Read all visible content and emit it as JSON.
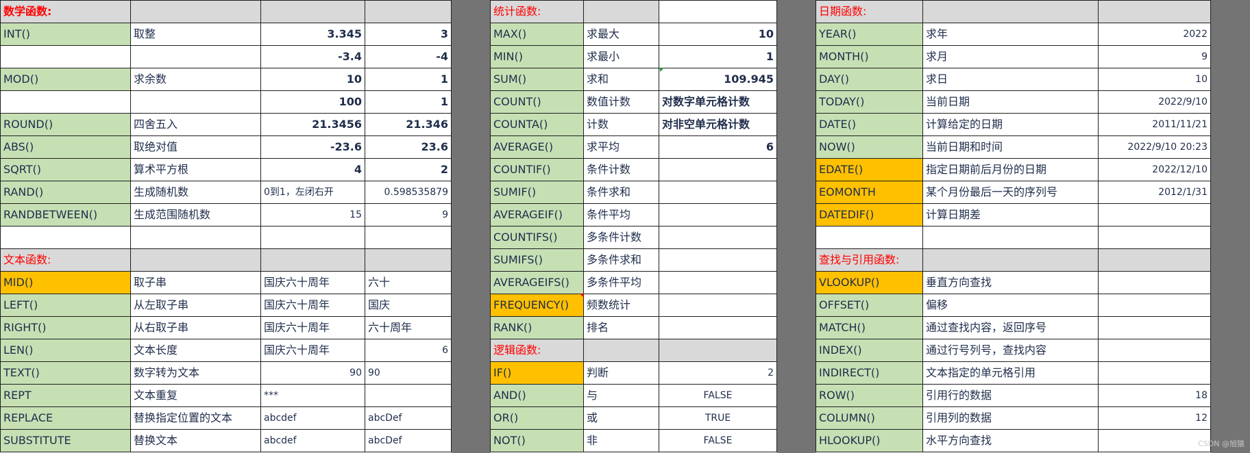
{
  "panels": {
    "left": {
      "widths": [
        190,
        190,
        152,
        126
      ],
      "rows": [
        [
          {
            "t": "数学函数:",
            "s": "hd b"
          },
          {
            "t": "",
            "s": "hd"
          },
          {
            "t": "",
            "s": "hd"
          },
          {
            "t": "",
            "s": "hd"
          }
        ],
        [
          {
            "t": "INT()",
            "s": "fn"
          },
          {
            "t": "取整",
            "s": ""
          },
          {
            "t": "3.345",
            "s": "r b"
          },
          {
            "t": "3",
            "s": "r b"
          }
        ],
        [
          {
            "t": "",
            "s": ""
          },
          {
            "t": "",
            "s": ""
          },
          {
            "t": "-3.4",
            "s": "r b"
          },
          {
            "t": "-4",
            "s": "r b"
          }
        ],
        [
          {
            "t": "MOD()",
            "s": "fn"
          },
          {
            "t": "求余数",
            "s": ""
          },
          {
            "t": "10",
            "s": "r b"
          },
          {
            "t": "1",
            "s": "r b"
          }
        ],
        [
          {
            "t": "",
            "s": ""
          },
          {
            "t": "",
            "s": ""
          },
          {
            "t": "100",
            "s": "r b"
          },
          {
            "t": "1",
            "s": "r b"
          }
        ],
        [
          {
            "t": "ROUND()",
            "s": "fn"
          },
          {
            "t": "四舍五入",
            "s": ""
          },
          {
            "t": "21.3456",
            "s": "r b"
          },
          {
            "t": "21.346",
            "s": "r b"
          }
        ],
        [
          {
            "t": "ABS()",
            "s": "fn"
          },
          {
            "t": "取绝对值",
            "s": ""
          },
          {
            "t": "-23.6",
            "s": "r b"
          },
          {
            "t": "23.6",
            "s": "r b"
          }
        ],
        [
          {
            "t": "SQRT()",
            "s": "fn"
          },
          {
            "t": "算术平方根",
            "s": ""
          },
          {
            "t": "4",
            "s": "r b"
          },
          {
            "t": "2",
            "s": "r b"
          }
        ],
        [
          {
            "t": "RAND()",
            "s": "fn"
          },
          {
            "t": "生成随机数",
            "s": ""
          },
          {
            "t": "0到1，左闭右开",
            "s": "sm"
          },
          {
            "t": "0.598535879",
            "s": "r sm"
          }
        ],
        [
          {
            "t": "RANDBETWEEN()",
            "s": "fn"
          },
          {
            "t": "生成范围随机数",
            "s": ""
          },
          {
            "t": "15",
            "s": "r sm"
          },
          {
            "t": "9",
            "s": "r sm"
          }
        ],
        [
          {
            "t": "",
            "s": ""
          },
          {
            "t": "",
            "s": ""
          },
          {
            "t": "",
            "s": ""
          },
          {
            "t": "",
            "s": ""
          }
        ],
        [
          {
            "t": "文本函数:",
            "s": "hd"
          },
          {
            "t": "",
            "s": "hd"
          },
          {
            "t": "",
            "s": "hd"
          },
          {
            "t": "",
            "s": "hd"
          }
        ],
        [
          {
            "t": "MID()",
            "s": "fy"
          },
          {
            "t": "取子串",
            "s": ""
          },
          {
            "t": "国庆六十周年",
            "s": ""
          },
          {
            "t": "六十",
            "s": ""
          }
        ],
        [
          {
            "t": "LEFT()",
            "s": "fn"
          },
          {
            "t": "从左取子串",
            "s": ""
          },
          {
            "t": "国庆六十周年",
            "s": ""
          },
          {
            "t": "国庆",
            "s": ""
          }
        ],
        [
          {
            "t": "RIGHT()",
            "s": "fn"
          },
          {
            "t": "从右取子串",
            "s": ""
          },
          {
            "t": "国庆六十周年",
            "s": ""
          },
          {
            "t": "六十周年",
            "s": ""
          }
        ],
        [
          {
            "t": "LEN()",
            "s": "fn"
          },
          {
            "t": "文本长度",
            "s": ""
          },
          {
            "t": "国庆六十周年",
            "s": ""
          },
          {
            "t": "6",
            "s": "r sm"
          }
        ],
        [
          {
            "t": "TEXT()",
            "s": "fn"
          },
          {
            "t": "数字转为文本",
            "s": ""
          },
          {
            "t": "90",
            "s": "r sm"
          },
          {
            "t": "90",
            "s": "sm"
          }
        ],
        [
          {
            "t": "REPT",
            "s": "fn"
          },
          {
            "t": "文本重复",
            "s": ""
          },
          {
            "t": "***",
            "s": "sm"
          },
          {
            "t": "",
            "s": ""
          }
        ],
        [
          {
            "t": "REPLACE",
            "s": "fn"
          },
          {
            "t": "替换指定位置的文本",
            "s": ""
          },
          {
            "t": "abcdef",
            "s": "sm"
          },
          {
            "t": "abcDef",
            "s": "sm"
          }
        ],
        [
          {
            "t": "SUBSTITUTE",
            "s": "fn"
          },
          {
            "t": "替换文本",
            "s": ""
          },
          {
            "t": "abcdef",
            "s": "sm"
          },
          {
            "t": "abcDef",
            "s": "sm"
          }
        ]
      ]
    },
    "middle": {
      "widths": [
        136,
        110,
        172
      ],
      "rows": [
        [
          {
            "t": "统计函数:",
            "s": "hd"
          },
          {
            "t": "",
            "s": "hd"
          },
          {
            "t": "",
            "s": ""
          }
        ],
        [
          {
            "t": "MAX()",
            "s": "fn"
          },
          {
            "t": "求最大",
            "s": ""
          },
          {
            "t": "10",
            "s": "r b"
          }
        ],
        [
          {
            "t": "MIN()",
            "s": "fn"
          },
          {
            "t": "求最小",
            "s": ""
          },
          {
            "t": "1",
            "s": "r b"
          }
        ],
        [
          {
            "t": "SUM()",
            "s": "fn"
          },
          {
            "t": "求和",
            "s": ""
          },
          {
            "t": "109.945",
            "s": "r b"
          }
        ],
        [
          {
            "t": "COUNT()",
            "s": "fn"
          },
          {
            "t": "数值计数",
            "s": ""
          },
          {
            "t": "对数字单元格计数",
            "s": "b"
          }
        ],
        [
          {
            "t": "COUNTA()",
            "s": "fn"
          },
          {
            "t": "计数",
            "s": ""
          },
          {
            "t": "对非空单元格计数",
            "s": "b"
          }
        ],
        [
          {
            "t": "AVERAGE()",
            "s": "fn"
          },
          {
            "t": "求平均",
            "s": ""
          },
          {
            "t": "6",
            "s": "r b"
          }
        ],
        [
          {
            "t": "COUNTIF()",
            "s": "fn"
          },
          {
            "t": "条件计数",
            "s": ""
          },
          {
            "t": "",
            "s": ""
          }
        ],
        [
          {
            "t": "SUMIF()",
            "s": "fn"
          },
          {
            "t": "条件求和",
            "s": ""
          },
          {
            "t": "",
            "s": ""
          }
        ],
        [
          {
            "t": "AVERAGEIF()",
            "s": "fn"
          },
          {
            "t": "条件平均",
            "s": ""
          },
          {
            "t": "",
            "s": ""
          }
        ],
        [
          {
            "t": "COUNTIFS()",
            "s": "fn"
          },
          {
            "t": "多条件计数",
            "s": ""
          },
          {
            "t": "",
            "s": ""
          }
        ],
        [
          {
            "t": "SUMIFS()",
            "s": "fn"
          },
          {
            "t": "多条件求和",
            "s": ""
          },
          {
            "t": "",
            "s": ""
          }
        ],
        [
          {
            "t": "AVERAGEIFS()",
            "s": "fn"
          },
          {
            "t": "多条件平均",
            "s": ""
          },
          {
            "t": "",
            "s": ""
          }
        ],
        [
          {
            "t": "FREQUENCY()",
            "s": "fy"
          },
          {
            "t": "频数统计",
            "s": ""
          },
          {
            "t": "",
            "s": ""
          }
        ],
        [
          {
            "t": "RANK()",
            "s": "fn"
          },
          {
            "t": "排名",
            "s": ""
          },
          {
            "t": "",
            "s": ""
          }
        ],
        [
          {
            "t": "逻辑函数:",
            "s": "hd"
          },
          {
            "t": "",
            "s": "hd"
          },
          {
            "t": "",
            "s": "hd"
          }
        ],
        [
          {
            "t": "IF()",
            "s": "fy"
          },
          {
            "t": "判断",
            "s": ""
          },
          {
            "t": "2",
            "s": "r sm"
          }
        ],
        [
          {
            "t": "AND()",
            "s": "fn"
          },
          {
            "t": "与",
            "s": ""
          },
          {
            "t": "FALSE",
            "s": "c sm"
          }
        ],
        [
          {
            "t": "OR()",
            "s": "fn"
          },
          {
            "t": "或",
            "s": ""
          },
          {
            "t": "TRUE",
            "s": "c sm"
          }
        ],
        [
          {
            "t": "NOT()",
            "s": "fn"
          },
          {
            "t": "非",
            "s": ""
          },
          {
            "t": "FALSE",
            "s": "c sm"
          }
        ]
      ]
    },
    "right": {
      "widths": [
        156,
        256,
        164
      ],
      "rows": [
        [
          {
            "t": "日期函数:",
            "s": "hd"
          },
          {
            "t": "",
            "s": "hd"
          },
          {
            "t": "",
            "s": "hd"
          }
        ],
        [
          {
            "t": "YEAR()",
            "s": "fn"
          },
          {
            "t": "求年",
            "s": ""
          },
          {
            "t": "2022",
            "s": "r sm"
          }
        ],
        [
          {
            "t": "MONTH()",
            "s": "fn"
          },
          {
            "t": "求月",
            "s": ""
          },
          {
            "t": "9",
            "s": "r sm"
          }
        ],
        [
          {
            "t": "DAY()",
            "s": "fn"
          },
          {
            "t": "求日",
            "s": ""
          },
          {
            "t": "10",
            "s": "r sm"
          }
        ],
        [
          {
            "t": "TODAY()",
            "s": "fn"
          },
          {
            "t": "当前日期",
            "s": ""
          },
          {
            "t": "2022/9/10",
            "s": "r sm"
          }
        ],
        [
          {
            "t": "DATE()",
            "s": "fn"
          },
          {
            "t": "计算给定的日期",
            "s": ""
          },
          {
            "t": "2011/11/21",
            "s": "r sm"
          }
        ],
        [
          {
            "t": "NOW()",
            "s": "fn"
          },
          {
            "t": "当前日期和时间",
            "s": ""
          },
          {
            "t": "2022/9/10 20:23",
            "s": "r sm"
          }
        ],
        [
          {
            "t": "EDATE()",
            "s": "fy"
          },
          {
            "t": "指定日期前后月份的日期",
            "s": ""
          },
          {
            "t": "2022/12/10",
            "s": "r sm"
          }
        ],
        [
          {
            "t": "EOMONTH",
            "s": "fy"
          },
          {
            "t": "某个月份最后一天的序列号",
            "s": ""
          },
          {
            "t": "2012/1/31",
            "s": "r sm"
          }
        ],
        [
          {
            "t": "DATEDIF()",
            "s": "fy"
          },
          {
            "t": "计算日期差",
            "s": ""
          },
          {
            "t": "",
            "s": ""
          }
        ],
        [
          {
            "t": "",
            "s": ""
          },
          {
            "t": "",
            "s": ""
          },
          {
            "t": "",
            "s": ""
          }
        ],
        [
          {
            "t": "查找与引用函数:",
            "s": "hd"
          },
          {
            "t": "",
            "s": "hd"
          },
          {
            "t": "",
            "s": "hd"
          }
        ],
        [
          {
            "t": "VLOOKUP()",
            "s": "fy"
          },
          {
            "t": "垂直方向查找",
            "s": ""
          },
          {
            "t": "",
            "s": ""
          }
        ],
        [
          {
            "t": "OFFSET()",
            "s": "fn"
          },
          {
            "t": "偏移",
            "s": ""
          },
          {
            "t": "",
            "s": ""
          }
        ],
        [
          {
            "t": "MATCH()",
            "s": "fn"
          },
          {
            "t": "通过查找内容，返回序号",
            "s": ""
          },
          {
            "t": "",
            "s": ""
          }
        ],
        [
          {
            "t": "INDEX()",
            "s": "fn"
          },
          {
            "t": "通过行号列号，查找内容",
            "s": ""
          },
          {
            "t": "",
            "s": ""
          }
        ],
        [
          {
            "t": "INDIRECT()",
            "s": "fn"
          },
          {
            "t": "文本指定的单元格引用",
            "s": ""
          },
          {
            "t": "",
            "s": ""
          }
        ],
        [
          {
            "t": "ROW()",
            "s": "fn"
          },
          {
            "t": "引用行的数据",
            "s": ""
          },
          {
            "t": "18",
            "s": "r sm"
          }
        ],
        [
          {
            "t": "COLUMN()",
            "s": "fn"
          },
          {
            "t": "引用列的数据",
            "s": ""
          },
          {
            "t": "12",
            "s": "r sm"
          }
        ],
        [
          {
            "t": "HLOOKUP()",
            "s": "fn"
          },
          {
            "t": "水平方向查找",
            "s": ""
          },
          {
            "t": "",
            "s": ""
          }
        ]
      ]
    }
  },
  "watermark": "CSDN @旭猿",
  "colors": {
    "header_bg": "#d9d9d9",
    "header_text": "#ff0000",
    "function_green": "#c6e0b4",
    "function_orange": "#ffc000",
    "separator_gray": "#747474",
    "text": "#1f2d4a"
  }
}
